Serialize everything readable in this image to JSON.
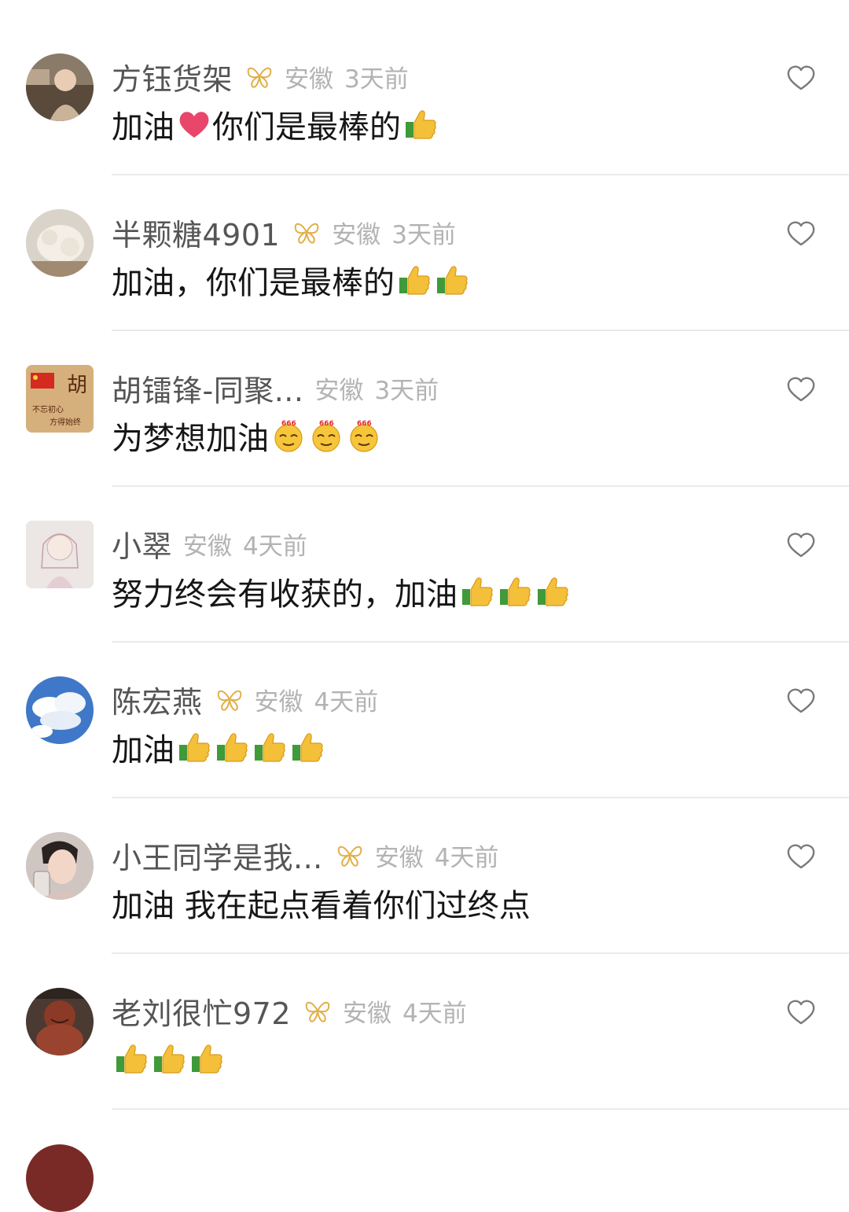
{
  "comments": [
    {
      "name": "方钰货架",
      "badge": true,
      "location": "安徽",
      "time": "3天前",
      "text": "加油",
      "text_after": "你们是最棒的",
      "emojis_mid": [
        "heart"
      ],
      "emojis_end": [
        "thumbs-up"
      ],
      "liked": false
    },
    {
      "name": "半颗糖4901",
      "badge": true,
      "location": "安徽",
      "time": "3天前",
      "text": "加油，你们是最棒的",
      "emojis_end": [
        "thumbs-up",
        "thumbs-up"
      ],
      "liked": false
    },
    {
      "name": "胡镭锋-同聚...",
      "badge": false,
      "location": "安徽",
      "time": "3天前",
      "text": "为梦想加油",
      "emojis_end": [
        "666-face",
        "666-face",
        "666-face"
      ],
      "liked": false
    },
    {
      "name": "小翠",
      "badge": false,
      "location": "安徽",
      "time": "4天前",
      "text": "努力终会有收获的，加油",
      "emojis_end": [
        "thumbs-up",
        "thumbs-up",
        "thumbs-up"
      ],
      "liked": false
    },
    {
      "name": "陈宏燕",
      "badge": true,
      "location": "安徽",
      "time": "4天前",
      "text": "加油",
      "emojis_end": [
        "thumbs-up",
        "thumbs-up",
        "thumbs-up",
        "thumbs-up"
      ],
      "liked": false
    },
    {
      "name": "小王同学是我...",
      "badge": true,
      "location": "安徽",
      "time": "4天前",
      "text": "加油 我在起点看着你们过终点",
      "emojis_end": [],
      "liked": false
    },
    {
      "name": "老刘很忙972",
      "badge": true,
      "location": "安徽",
      "time": "4天前",
      "text": "",
      "emojis_end": [
        "thumbs-up",
        "thumbs-up",
        "thumbs-up"
      ],
      "liked": false
    }
  ],
  "icons": {
    "like": "heart-outline-icon",
    "badge": "butterfly-badge-icon"
  },
  "colors": {
    "name": "#555555",
    "meta": "#b3b3b3",
    "text": "#161616",
    "divider": "#ebebeb",
    "badge": "#e0b04a"
  }
}
